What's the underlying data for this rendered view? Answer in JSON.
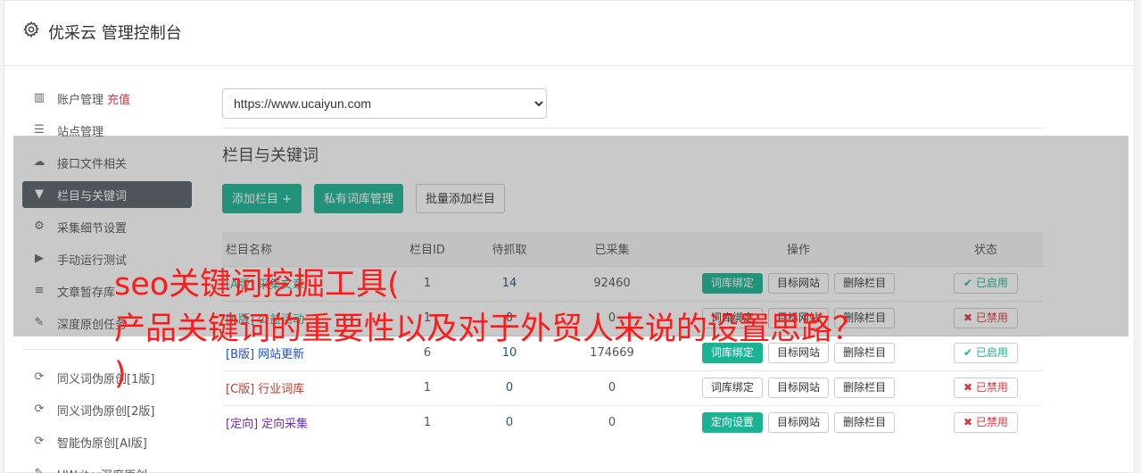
{
  "header": {
    "title": "优采云 管理控制台",
    "icon": "gear-icon"
  },
  "sidebar": {
    "items": [
      {
        "label": "账户管理",
        "extra": "充值",
        "icon": "bar-chart-icon"
      },
      {
        "label": "站点管理",
        "icon": "server-icon"
      },
      {
        "label": "接口文件相关",
        "icon": "cloud-upload-icon"
      },
      {
        "label": "栏目与关键词",
        "icon": "filter-icon",
        "active": true
      },
      {
        "label": "采集细节设置",
        "icon": "cogs-icon"
      },
      {
        "label": "手动运行测试",
        "icon": "play-circle-icon"
      },
      {
        "label": "文章暂存库",
        "icon": "database-icon"
      },
      {
        "label": "深度原创任务",
        "icon": "edit-icon"
      }
    ],
    "tools": [
      {
        "label": "同义词伪原创[1版]",
        "icon": "refresh-icon"
      },
      {
        "label": "同义词伪原创[2版]",
        "icon": "refresh-icon"
      },
      {
        "label": "智能伪原创[AI版]",
        "icon": "refresh-icon"
      },
      {
        "label": "UWriter深度原创",
        "icon": "edit-icon"
      }
    ]
  },
  "site_select": {
    "value": "https://www.ucaiyun.com"
  },
  "section": {
    "title": "栏目与关键词",
    "buttons": {
      "add": "添加栏目 +",
      "private": "私有词库管理",
      "batch": "批量添加栏目"
    }
  },
  "table": {
    "headers": [
      "栏目名称",
      "栏目ID",
      "待抓取",
      "已采集",
      "操作",
      "状态"
    ],
    "rows": [
      {
        "tag": "[A版]",
        "name": "采集文章",
        "color": "green",
        "id": "1",
        "pending": "14",
        "collected": "92460",
        "op1": "词库绑定",
        "op1_green": true,
        "op2": "目标网站",
        "op3": "删除栏目",
        "status": "已启用",
        "on": true
      },
      {
        "tag": "[A版]",
        "name": "公益活动",
        "color": "green",
        "id": "1",
        "pending": "0",
        "collected": "0",
        "op1": "词库绑定",
        "op1_green": false,
        "op2": "目标网站",
        "op3": "删除栏目",
        "status": "已禁用",
        "on": false
      },
      {
        "tag": "[B版]",
        "name": "网站更新",
        "color": "blue",
        "id": "6",
        "pending": "10",
        "collected": "174669",
        "op1": "词库绑定",
        "op1_green": true,
        "op2": "目标网站",
        "op3": "删除栏目",
        "status": "已启用",
        "on": true
      },
      {
        "tag": "[C版]",
        "name": "行业词库",
        "color": "red",
        "id": "1",
        "pending": "0",
        "collected": "0",
        "op1": "词库绑定",
        "op1_green": false,
        "op2": "目标网站",
        "op3": "删除栏目",
        "status": "已禁用",
        "on": false
      },
      {
        "tag": "[定向]",
        "name": "定向采集",
        "color": "purple",
        "id": "1",
        "pending": "0",
        "collected": "0",
        "op1": "定向设置",
        "op1_green": true,
        "op2": "目标网站",
        "op3": "删除栏目",
        "status": "已禁用",
        "on": false
      }
    ]
  },
  "overlay_title": {
    "line1": "seo关键词挖掘工具(",
    "line2": "产品关键词的重要性以及对于外贸人来说的设置思路？",
    "line3": ")"
  },
  "colors": {
    "accent": "#1ab394",
    "danger": "#d9363e",
    "overlay_text": "#ff1a1a"
  }
}
